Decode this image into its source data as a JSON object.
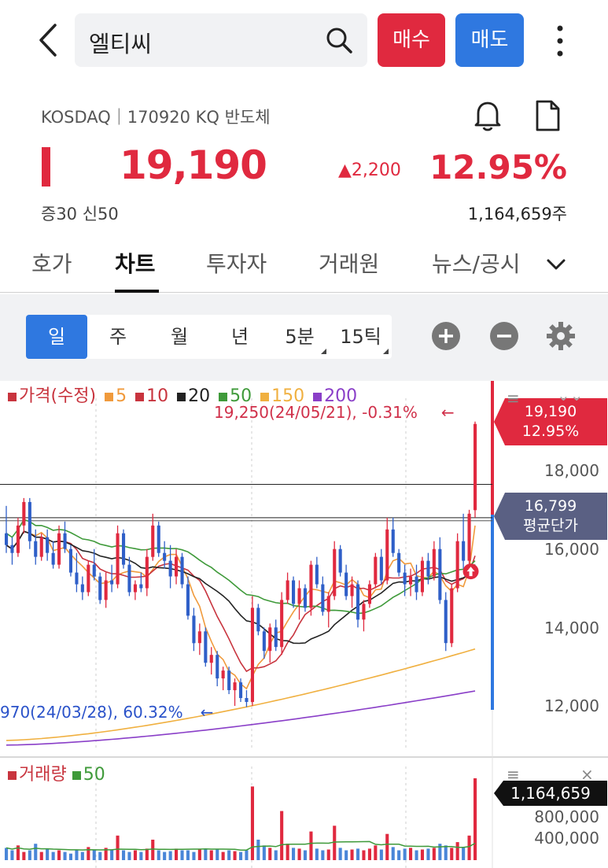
{
  "header": {
    "search_text": "엘티씨",
    "buy_label": "매수",
    "sell_label": "매도"
  },
  "stock": {
    "exchange_line": "KOSDAQ｜170920 KQ 반도체",
    "price": "19,190",
    "change": "2,200",
    "change_pct": "12.95%",
    "margin_info": "증30  신50",
    "volume": "1,164,659주"
  },
  "tabs": [
    "호가",
    "차트",
    "투자자",
    "거래원",
    "뉴스/공시"
  ],
  "periods": [
    "일",
    "주",
    "월",
    "년",
    "5분",
    "15틱"
  ],
  "legend": {
    "price": "가격(수정)",
    "ma5": "5",
    "ma10": "10",
    "ma20": "20",
    "ma50": "50",
    "ma150": "150",
    "ma200": "200"
  },
  "annotations": {
    "high": "19,250(24/05/21), -0.31%",
    "low": "970(24/03/28), 60.32%"
  },
  "axis": {
    "ticks": [
      "18,000",
      "16,000",
      "14,000",
      "12,000"
    ]
  },
  "tags": {
    "price": "19,190",
    "pct": "12.95%",
    "avg": "16,799",
    "avg_label": "평균단가",
    "vol": "1,164,659"
  },
  "volume_panel": {
    "label": "거래량",
    "ma": "50",
    "ticks": [
      "800,000",
      "400,000"
    ]
  },
  "colors": {
    "up": "#e0293f",
    "down": "#2f5fc8",
    "ma5": "#f09a3c",
    "ma10": "#c8343e",
    "ma20": "#222222",
    "ma50": "#3f9a3a",
    "ma150": "#f0b040",
    "ma200": "#8a3fc8"
  },
  "chart_data": {
    "type": "candlestick",
    "y_range": [
      11000,
      20000
    ],
    "candles": [
      [
        16400,
        17100,
        15900,
        16100
      ],
      [
        16100,
        16300,
        15600,
        15900
      ],
      [
        15900,
        16800,
        15800,
        16600
      ],
      [
        16600,
        17300,
        16400,
        17200
      ],
      [
        17200,
        17300,
        16000,
        16200
      ],
      [
        16200,
        16500,
        15600,
        15800
      ],
      [
        15800,
        16400,
        15700,
        16300
      ],
      [
        16300,
        16500,
        15700,
        15900
      ],
      [
        15900,
        16200,
        15500,
        15600
      ],
      [
        15600,
        16600,
        15500,
        16400
      ],
      [
        16400,
        16700,
        15900,
        16000
      ],
      [
        16000,
        16100,
        15300,
        15400
      ],
      [
        15400,
        15900,
        14900,
        15100
      ],
      [
        15100,
        15300,
        14700,
        14900
      ],
      [
        14900,
        15700,
        14800,
        15600
      ],
      [
        15600,
        16000,
        15200,
        15300
      ],
      [
        15300,
        15400,
        14600,
        14700
      ],
      [
        14700,
        15400,
        14500,
        15200
      ],
      [
        15200,
        15600,
        14900,
        15100
      ],
      [
        15100,
        16600,
        15000,
        16400
      ],
      [
        16400,
        16500,
        15500,
        15600
      ],
      [
        15600,
        15800,
        14800,
        14900
      ],
      [
        14900,
        15200,
        14700,
        15100
      ],
      [
        15100,
        15400,
        14900,
        15000
      ],
      [
        15000,
        16000,
        14800,
        15800
      ],
      [
        15800,
        16900,
        15700,
        16600
      ],
      [
        16600,
        16700,
        15800,
        15900
      ],
      [
        15900,
        16200,
        15500,
        15700
      ],
      [
        15700,
        16100,
        15000,
        15300
      ],
      [
        15300,
        16000,
        15100,
        15800
      ],
      [
        15800,
        15900,
        15000,
        15100
      ],
      [
        15100,
        15300,
        14200,
        14300
      ],
      [
        14300,
        14500,
        13400,
        13600
      ],
      [
        13600,
        14100,
        13300,
        13900
      ],
      [
        13900,
        14000,
        13000,
        13100
      ],
      [
        13100,
        13500,
        12800,
        13300
      ],
      [
        13300,
        13400,
        12500,
        12700
      ],
      [
        12700,
        13000,
        12400,
        12900
      ],
      [
        12900,
        13000,
        12300,
        12400
      ],
      [
        12400,
        12700,
        12000,
        12600
      ],
      [
        12600,
        12700,
        12100,
        12200
      ],
      [
        12200,
        12400,
        11970,
        12100
      ],
      [
        12100,
        14800,
        12000,
        14500
      ],
      [
        14500,
        14600,
        13800,
        13900
      ],
      [
        13900,
        14000,
        13200,
        13400
      ],
      [
        13400,
        14100,
        13100,
        14000
      ],
      [
        14000,
        14200,
        13400,
        13500
      ],
      [
        13500,
        14900,
        13300,
        14700
      ],
      [
        14700,
        15400,
        14600,
        15200
      ],
      [
        15200,
        15300,
        14500,
        14600
      ],
      [
        14600,
        15200,
        14200,
        15000
      ],
      [
        15000,
        15100,
        14400,
        14500
      ],
      [
        14500,
        15700,
        14300,
        15600
      ],
      [
        15600,
        15800,
        15000,
        15100
      ],
      [
        15100,
        15300,
        14300,
        14400
      ],
      [
        14400,
        14900,
        14000,
        14800
      ],
      [
        14800,
        16200,
        14700,
        16000
      ],
      [
        16000,
        16100,
        15300,
        15400
      ],
      [
        15400,
        15600,
        14700,
        14800
      ],
      [
        14800,
        15300,
        14500,
        15100
      ],
      [
        15100,
        15200,
        14000,
        14200
      ],
      [
        14200,
        14700,
        13900,
        14600
      ],
      [
        14600,
        15200,
        14500,
        15100
      ],
      [
        15100,
        15900,
        15000,
        15800
      ],
      [
        15800,
        16000,
        15100,
        15200
      ],
      [
        15200,
        16800,
        15100,
        16500
      ],
      [
        16500,
        16800,
        15800,
        15900
      ],
      [
        15900,
        16000,
        15300,
        15400
      ],
      [
        15400,
        15600,
        14800,
        15100
      ],
      [
        15100,
        15500,
        14800,
        15300
      ],
      [
        15300,
        15600,
        14700,
        14900
      ],
      [
        14900,
        15800,
        14800,
        15700
      ],
      [
        15700,
        15900,
        15100,
        15300
      ],
      [
        15300,
        16200,
        15200,
        16000
      ],
      [
        16000,
        16300,
        14600,
        14700
      ],
      [
        14700,
        14900,
        13400,
        13600
      ],
      [
        13600,
        15100,
        13500,
        15000
      ],
      [
        15000,
        16400,
        14900,
        16200
      ],
      [
        16200,
        16900,
        15500,
        15700
      ],
      [
        15700,
        17000,
        15600,
        16900
      ],
      [
        16990,
        19250,
        16800,
        19190
      ]
    ],
    "volumes": [
      0.15,
      0.12,
      0.18,
      0.1,
      0.12,
      0.2,
      0.1,
      0.14,
      0.1,
      0.12,
      0.1,
      0.08,
      0.13,
      0.1,
      0.16,
      0.12,
      0.1,
      0.15,
      0.12,
      0.3,
      0.12,
      0.1,
      0.12,
      0.1,
      0.14,
      0.25,
      0.12,
      0.1,
      0.11,
      0.14,
      0.12,
      0.12,
      0.1,
      0.13,
      0.14,
      0.12,
      0.13,
      0.1,
      0.12,
      0.11,
      0.1,
      0.12,
      0.9,
      0.25,
      0.18,
      0.15,
      0.12,
      0.6,
      0.2,
      0.15,
      0.14,
      0.12,
      0.35,
      0.14,
      0.12,
      0.13,
      0.42,
      0.15,
      0.12,
      0.13,
      0.14,
      0.12,
      0.14,
      0.18,
      0.13,
      0.32,
      0.16,
      0.12,
      0.14,
      0.15,
      0.12,
      0.13,
      0.14,
      0.15,
      0.2,
      0.18,
      0.15,
      0.22,
      0.16,
      0.3,
      1.0
    ]
  }
}
